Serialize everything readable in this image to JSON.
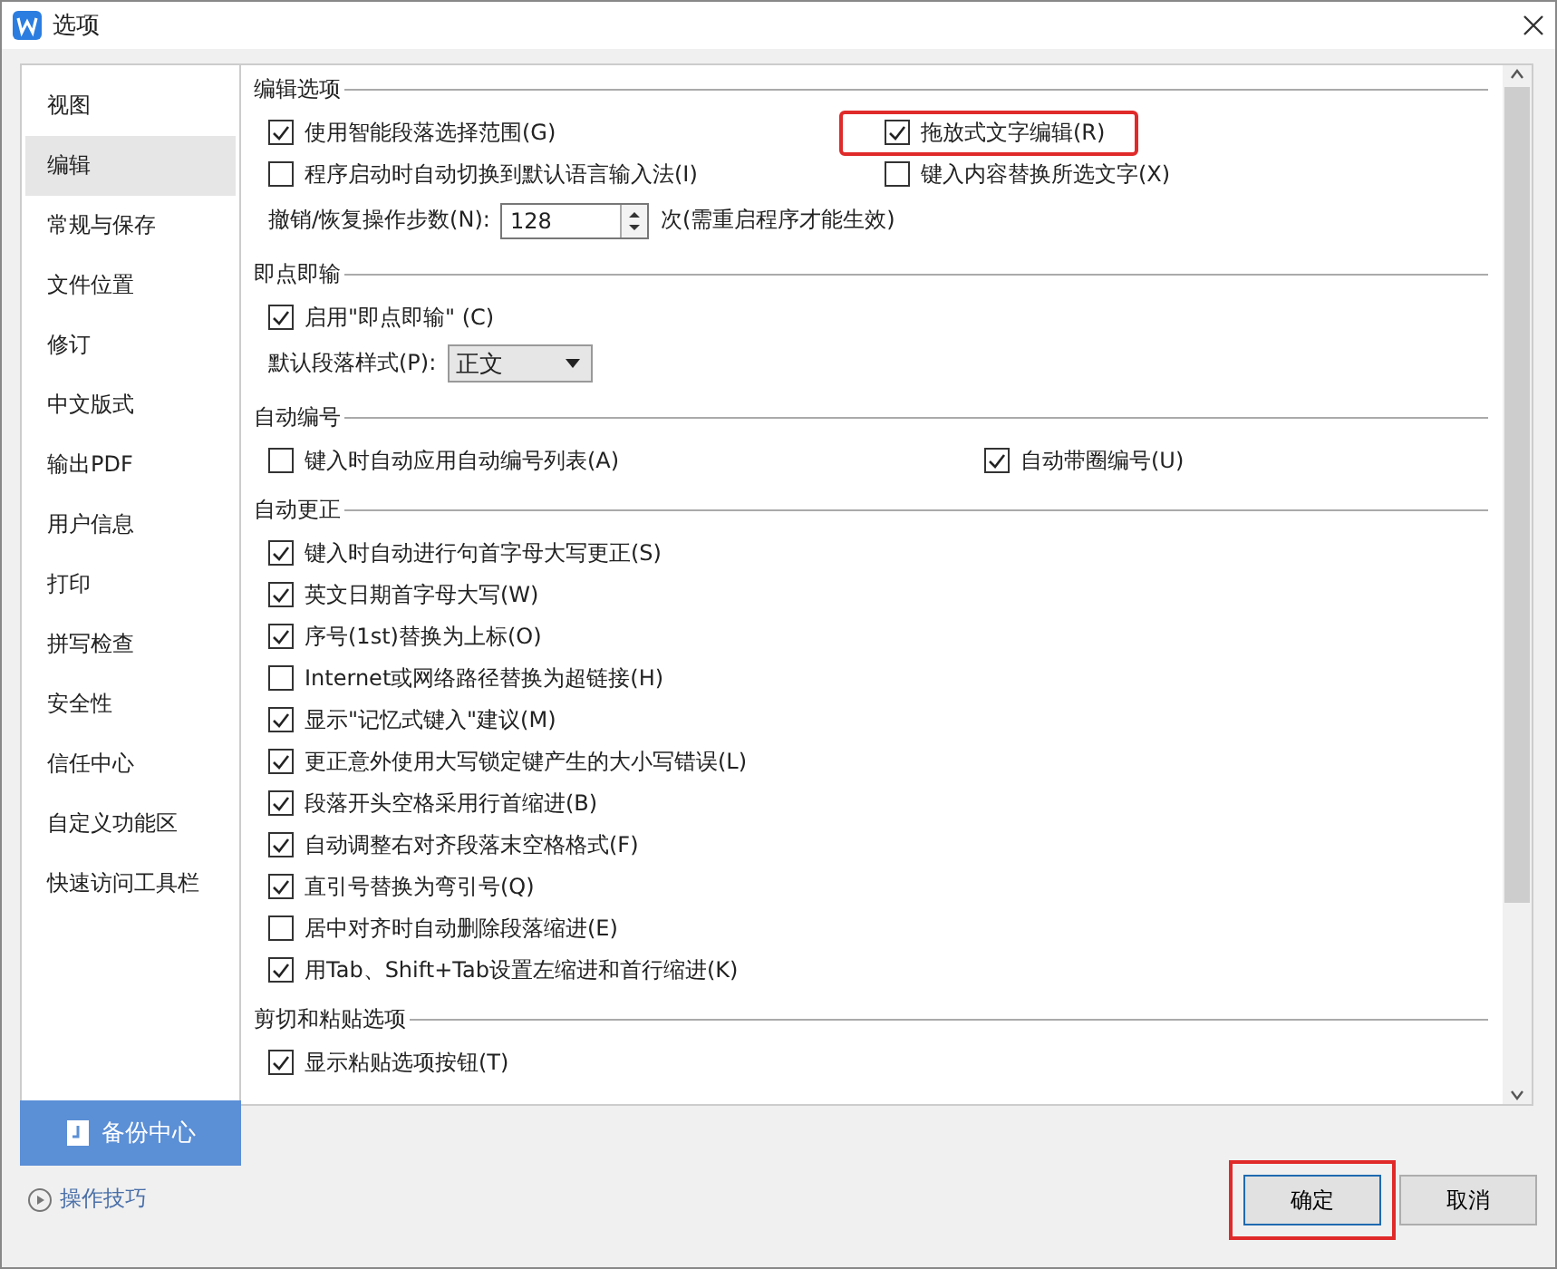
{
  "window": {
    "title": "选项"
  },
  "sidebar": {
    "items": [
      {
        "label": "视图",
        "selected": false
      },
      {
        "label": "编辑",
        "selected": true
      },
      {
        "label": "常规与保存",
        "selected": false
      },
      {
        "label": "文件位置",
        "selected": false
      },
      {
        "label": "修订",
        "selected": false
      },
      {
        "label": "中文版式",
        "selected": false
      },
      {
        "label": "输出PDF",
        "selected": false
      },
      {
        "label": "用户信息",
        "selected": false
      },
      {
        "label": "打印",
        "selected": false
      },
      {
        "label": "拼写检查",
        "selected": false
      },
      {
        "label": "安全性",
        "selected": false
      },
      {
        "label": "信任中心",
        "selected": false
      },
      {
        "label": "自定义功能区",
        "selected": false
      },
      {
        "label": "快速访问工具栏",
        "selected": false
      }
    ],
    "backup_button": "备份中心",
    "tips_link": "操作技巧"
  },
  "sections": [
    {
      "title": "编辑选项",
      "rows": [
        {
          "kind": "pair",
          "items": [
            {
              "label": "使用智能段落选择范围(G)",
              "checked": true,
              "highlighted": false
            },
            {
              "label": "拖放式文字编辑(R)",
              "checked": true,
              "highlighted": true
            }
          ]
        },
        {
          "kind": "pair",
          "items": [
            {
              "label": "程序启动时自动切换到默认语言输入法(I)",
              "checked": false,
              "highlighted": false
            },
            {
              "label": "键入内容替换所选文字(X)",
              "checked": false,
              "highlighted": false
            }
          ]
        },
        {
          "kind": "spinner",
          "label": "撤销/恢复操作步数(N):",
          "value": "128",
          "suffix": "次(需重启程序才能生效)"
        }
      ]
    },
    {
      "title": "即点即输",
      "rows": [
        {
          "kind": "pair",
          "items": [
            {
              "label": "启用\"即点即输\" (C)",
              "checked": true,
              "highlighted": false
            }
          ]
        },
        {
          "kind": "dropdown",
          "label": "默认段落样式(P):",
          "value": "正文"
        }
      ]
    },
    {
      "title": "自动编号",
      "rows": [
        {
          "kind": "pair",
          "items": [
            {
              "label": "键入时自动应用自动编号列表(A)",
              "checked": false,
              "highlighted": false
            },
            {
              "label": "自动带圈编号(U)",
              "checked": true,
              "highlighted": false
            }
          ]
        }
      ]
    },
    {
      "title": "自动更正",
      "rows": [
        {
          "kind": "pair",
          "items": [
            {
              "label": "键入时自动进行句首字母大写更正(S)",
              "checked": true,
              "highlighted": false
            }
          ]
        },
        {
          "kind": "pair",
          "items": [
            {
              "label": "英文日期首字母大写(W)",
              "checked": true,
              "highlighted": false
            }
          ]
        },
        {
          "kind": "pair",
          "items": [
            {
              "label": "序号(1st)替换为上标(O)",
              "checked": true,
              "highlighted": false
            }
          ]
        },
        {
          "kind": "pair",
          "items": [
            {
              "label": "Internet或网络路径替换为超链接(H)",
              "checked": false,
              "highlighted": false
            }
          ]
        },
        {
          "kind": "pair",
          "items": [
            {
              "label": "显示\"记忆式键入\"建议(M)",
              "checked": true,
              "highlighted": false
            }
          ]
        },
        {
          "kind": "pair",
          "items": [
            {
              "label": "更正意外使用大写锁定键产生的大小写错误(L)",
              "checked": true,
              "highlighted": false
            }
          ]
        },
        {
          "kind": "pair",
          "items": [
            {
              "label": "段落开头空格采用行首缩进(B)",
              "checked": true,
              "highlighted": false
            }
          ]
        },
        {
          "kind": "pair",
          "items": [
            {
              "label": "自动调整右对齐段落末空格格式(F)",
              "checked": true,
              "highlighted": false
            }
          ]
        },
        {
          "kind": "pair",
          "items": [
            {
              "label": "直引号替换为弯引号(Q)",
              "checked": true,
              "highlighted": false
            }
          ]
        },
        {
          "kind": "pair",
          "items": [
            {
              "label": "居中对齐时自动删除段落缩进(E)",
              "checked": false,
              "highlighted": false
            }
          ]
        },
        {
          "kind": "pair",
          "items": [
            {
              "label": "用Tab、Shift+Tab设置左缩进和首行缩进(K)",
              "checked": true,
              "highlighted": false
            }
          ]
        }
      ]
    },
    {
      "title": "剪切和粘贴选项",
      "rows": [
        {
          "kind": "pair",
          "items": [
            {
              "label": "显示粘贴选项按钮(T)",
              "checked": true,
              "highlighted": false
            }
          ]
        }
      ]
    }
  ],
  "buttons": [
    {
      "label": "确定",
      "highlighted": true
    },
    {
      "label": "取消",
      "highlighted": false
    }
  ]
}
